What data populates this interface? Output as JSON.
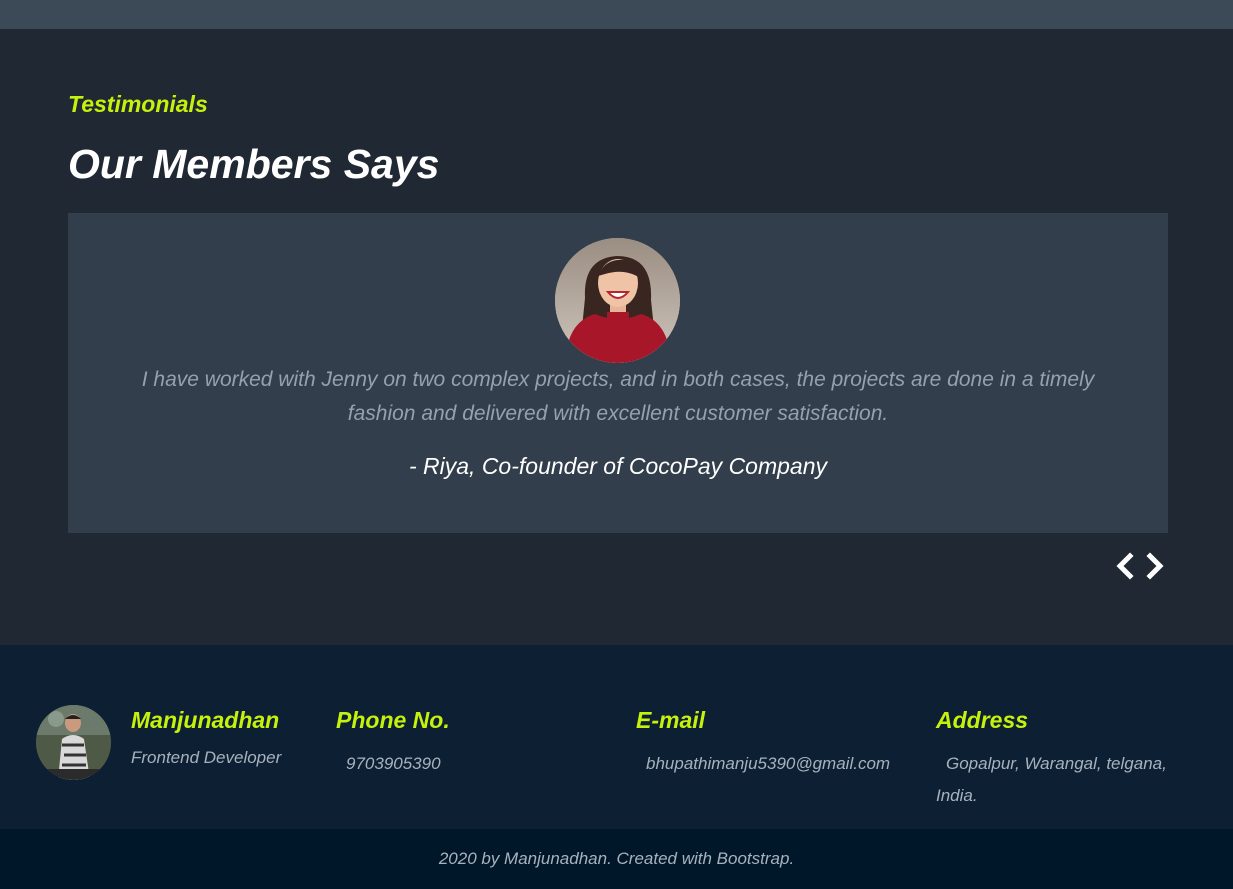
{
  "testimonials": {
    "eyebrow": "Testimonials",
    "title": "Our Members Says",
    "items": [
      {
        "quote": "I have worked with Jenny on two complex projects, and in both cases, the projects are done in a timely fashion and delivered with excellent customer satisfaction.",
        "author": "- Riya, Co-founder of CocoPay Company"
      }
    ],
    "nav": {
      "prev_icon": "chevron-left-icon",
      "next_icon": "chevron-right-icon"
    }
  },
  "footer": {
    "profile": {
      "name": "Manjunadhan",
      "role": "Frontend Developer"
    },
    "phone": {
      "heading": "Phone No.",
      "value": "9703905390"
    },
    "email": {
      "heading": "E-mail",
      "value": "bhupathimanju5390@gmail.com"
    },
    "address": {
      "heading": "Address",
      "line1": "Gopalpur, Warangal, telgana,",
      "line2": "India."
    },
    "copyright": "2020 by Manjunadhan. Created with Bootstrap."
  },
  "colors": {
    "accent": "#c5f10c",
    "section_bg": "#1f2833",
    "card_bg": "#323e4b",
    "footer_bg": "#0c1f33",
    "copyright_bg": "#001629"
  }
}
